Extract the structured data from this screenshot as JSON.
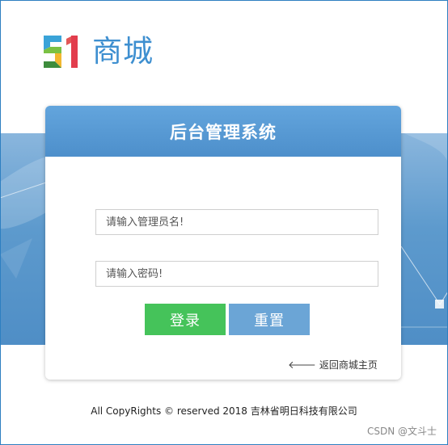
{
  "logo": {
    "icon": "51-logo-icon",
    "text": "商城"
  },
  "login_panel": {
    "title": "后台管理系统",
    "username_placeholder": "请输入管理员名!",
    "password_placeholder": "请输入密码!",
    "login_label": "登录",
    "reset_label": "重置",
    "back_arrow": "🡐",
    "back_label": "返回商城主页"
  },
  "footer": {
    "copyright": "All CopyRights © reserved 2018 吉林省明日科技有限公司"
  },
  "watermark": "CSDN @文斗士",
  "colors": {
    "accent": "#4d8fcb",
    "login_button": "#45c35a",
    "reset_button": "#6ba5d6",
    "logo_text": "#3e8fd0"
  }
}
